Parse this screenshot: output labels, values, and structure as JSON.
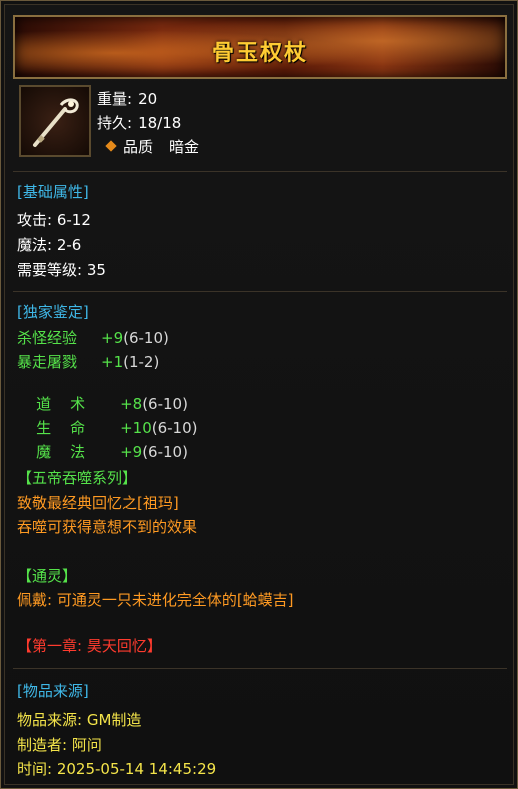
{
  "item": {
    "name": "骨玉权杖",
    "icon": "bone-scepter-icon",
    "weight_label": "重量:",
    "weight_value": "20",
    "durability_label": "持久:",
    "durability_value": "18/18",
    "quality_label": "品质",
    "quality_value": "暗金"
  },
  "base": {
    "title": "[基础属性]",
    "attack_label": "攻击:",
    "attack_value": "6-12",
    "magic_label": "魔法:",
    "magic_value": "2-6",
    "level_label": "需要等级:",
    "level_value": "35"
  },
  "appraisal": {
    "title": "[独家鉴定]",
    "rows": [
      {
        "name": "杀怪经验",
        "bonus": "+9",
        "range": "(6-10)"
      },
      {
        "name": "暴走屠戮",
        "bonus": "+1",
        "range": "(1-2)"
      },
      {
        "name": "道    术",
        "bonus": "+8",
        "range": "(6-10)"
      },
      {
        "name": "生    命",
        "bonus": "+10",
        "range": "(6-10)"
      },
      {
        "name": "魔    法",
        "bonus": "+9",
        "range": "(6-10)"
      }
    ]
  },
  "series": {
    "title": "【五帝吞噬系列】",
    "line1": "致敬最经典回忆之[祖玛]",
    "line2": "吞噬可获得意想不到的效果"
  },
  "spirit": {
    "title": "【通灵】",
    "desc": "佩戴: 可通灵一只未进化完全体的[蛤蟆吉]"
  },
  "chapter": {
    "title": "【第一章: 昊天回忆】"
  },
  "origin": {
    "title": "[物品来源]",
    "source_label": "物品来源:",
    "source_value": "GM制造",
    "maker_label": "制造者:",
    "maker_value": "阿问",
    "time_label": "时间:",
    "time_value": "2025-05-14 14:45:29"
  },
  "colors": {
    "title": "#ffcc33",
    "section": "#3fb8e8",
    "green": "#55e24a",
    "orange": "#ff9a22",
    "red": "#ff3b2e",
    "yellow": "#f4e44a"
  }
}
